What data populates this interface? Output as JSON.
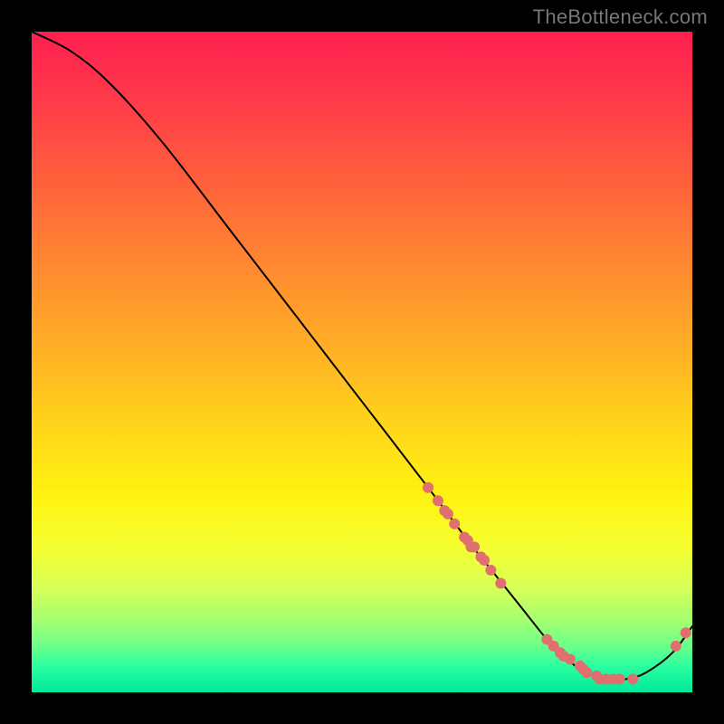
{
  "watermark": "TheBottleneck.com",
  "chart_data": {
    "type": "line",
    "title": "",
    "xlabel": "",
    "ylabel": "",
    "xlim": [
      0,
      100
    ],
    "ylim": [
      0,
      100
    ],
    "series": [
      {
        "name": "bottleneck-curve",
        "x": [
          0,
          6,
          12,
          20,
          30,
          40,
          50,
          60,
          66,
          70,
          74,
          78,
          81,
          84,
          87,
          90,
          93,
          97,
          100
        ],
        "values": [
          100,
          97,
          92,
          83,
          70,
          57,
          44,
          31,
          23,
          18,
          13,
          8,
          5,
          3,
          2,
          2,
          3,
          6,
          10
        ]
      }
    ],
    "markers": {
      "name": "highlighted-points",
      "color": "#e07070",
      "points": [
        {
          "x": 60.0,
          "y": 31.0
        },
        {
          "x": 61.5,
          "y": 29.0
        },
        {
          "x": 62.5,
          "y": 27.5
        },
        {
          "x": 63.0,
          "y": 27.0
        },
        {
          "x": 64.0,
          "y": 25.5
        },
        {
          "x": 65.5,
          "y": 23.5
        },
        {
          "x": 66.0,
          "y": 23.0
        },
        {
          "x": 66.5,
          "y": 22.0
        },
        {
          "x": 67.0,
          "y": 22.0
        },
        {
          "x": 68.0,
          "y": 20.5
        },
        {
          "x": 68.5,
          "y": 20.0
        },
        {
          "x": 69.5,
          "y": 18.5
        },
        {
          "x": 71.0,
          "y": 16.5
        },
        {
          "x": 78.0,
          "y": 8.0
        },
        {
          "x": 79.0,
          "y": 7.0
        },
        {
          "x": 80.0,
          "y": 6.0
        },
        {
          "x": 80.5,
          "y": 5.5
        },
        {
          "x": 81.5,
          "y": 5.0
        },
        {
          "x": 83.0,
          "y": 4.0
        },
        {
          "x": 83.5,
          "y": 3.5
        },
        {
          "x": 84.0,
          "y": 3.0
        },
        {
          "x": 85.5,
          "y": 2.5
        },
        {
          "x": 86.0,
          "y": 2.0
        },
        {
          "x": 87.0,
          "y": 2.0
        },
        {
          "x": 88.0,
          "y": 2.0
        },
        {
          "x": 89.0,
          "y": 2.0
        },
        {
          "x": 91.0,
          "y": 2.0
        },
        {
          "x": 97.5,
          "y": 7.0
        },
        {
          "x": 99.0,
          "y": 9.0
        }
      ]
    },
    "background": {
      "type": "vertical-gradient",
      "stops": [
        {
          "pos": 0.0,
          "color": "#ff1f4f"
        },
        {
          "pos": 0.5,
          "color": "#ffb025"
        },
        {
          "pos": 0.75,
          "color": "#f5ff30"
        },
        {
          "pos": 1.0,
          "color": "#00e89a"
        }
      ]
    }
  }
}
